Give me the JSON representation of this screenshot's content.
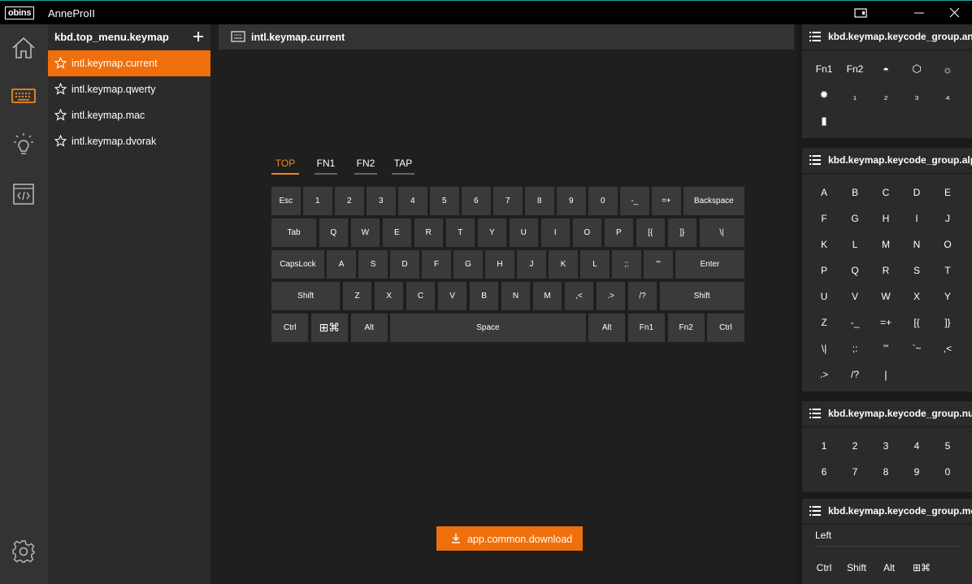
{
  "titlebar": {
    "logo": "obins",
    "app_title": "AnneProII"
  },
  "rail": {
    "items": [
      "home-icon",
      "keyboard-icon",
      "lightbulb-icon",
      "code-icon"
    ],
    "active": "keyboard-icon",
    "settings": "gear-icon"
  },
  "list": {
    "header": "kbd.top_menu.keymap",
    "add_icon": "plus-icon",
    "items": [
      {
        "label": "intl.keymap.current",
        "active": true
      },
      {
        "label": "intl.keymap.qwerty",
        "active": false
      },
      {
        "label": "intl.keymap.mac",
        "active": false
      },
      {
        "label": "intl.keymap.dvorak",
        "active": false
      }
    ]
  },
  "main": {
    "title": "intl.keymap.current",
    "tabs": [
      "TOP",
      "FN1",
      "FN2",
      "TAP"
    ],
    "active_tab": "TOP",
    "download_label": "app.common.download"
  },
  "keyboard": {
    "rows": [
      [
        {
          "l": "Esc",
          "w": 1
        },
        {
          "l": "1",
          "w": 1
        },
        {
          "l": "2",
          "w": 1
        },
        {
          "l": "3",
          "w": 1
        },
        {
          "l": "4",
          "w": 1
        },
        {
          "l": "5",
          "w": 1
        },
        {
          "l": "6",
          "w": 1
        },
        {
          "l": "7",
          "w": 1
        },
        {
          "l": "8",
          "w": 1
        },
        {
          "l": "9",
          "w": 1
        },
        {
          "l": "0",
          "w": 1
        },
        {
          "l": "-_",
          "w": 1
        },
        {
          "l": "=+",
          "w": 1
        },
        {
          "l": "Backspace",
          "w": 2
        }
      ],
      [
        {
          "l": "Tab",
          "w": 1.5
        },
        {
          "l": "Q",
          "w": 1
        },
        {
          "l": "W",
          "w": 1
        },
        {
          "l": "E",
          "w": 1
        },
        {
          "l": "R",
          "w": 1
        },
        {
          "l": "T",
          "w": 1
        },
        {
          "l": "Y",
          "w": 1
        },
        {
          "l": "U",
          "w": 1
        },
        {
          "l": "I",
          "w": 1
        },
        {
          "l": "O",
          "w": 1
        },
        {
          "l": "P",
          "w": 1
        },
        {
          "l": "[{",
          "w": 1
        },
        {
          "l": "]}",
          "w": 1
        },
        {
          "l": "\\|",
          "w": 1.5
        }
      ],
      [
        {
          "l": "CapsLock",
          "w": 1.75
        },
        {
          "l": "A",
          "w": 1
        },
        {
          "l": "S",
          "w": 1
        },
        {
          "l": "D",
          "w": 1
        },
        {
          "l": "F",
          "w": 1
        },
        {
          "l": "G",
          "w": 1
        },
        {
          "l": "H",
          "w": 1
        },
        {
          "l": "J",
          "w": 1
        },
        {
          "l": "K",
          "w": 1
        },
        {
          "l": "L",
          "w": 1
        },
        {
          "l": ";:",
          "w": 1
        },
        {
          "l": "'\"",
          "w": 1
        },
        {
          "l": "Enter",
          "w": 2.25
        }
      ],
      [
        {
          "l": "Shift",
          "w": 2.25
        },
        {
          "l": "Z",
          "w": 1
        },
        {
          "l": "X",
          "w": 1
        },
        {
          "l": "C",
          "w": 1
        },
        {
          "l": "V",
          "w": 1
        },
        {
          "l": "B",
          "w": 1
        },
        {
          "l": "N",
          "w": 1
        },
        {
          "l": "M",
          "w": 1
        },
        {
          "l": ",<",
          "w": 1
        },
        {
          "l": ".>",
          "w": 1
        },
        {
          "l": "/?",
          "w": 1
        },
        {
          "l": "Shift",
          "w": 2.75
        }
      ],
      [
        {
          "l": "Ctrl",
          "w": 1.25
        },
        {
          "l": "⊞⌘",
          "w": 1.25
        },
        {
          "l": "Alt",
          "w": 1.25
        },
        {
          "l": "Space",
          "w": 6.25
        },
        {
          "l": "Alt",
          "w": 1.25
        },
        {
          "l": "Fn1",
          "w": 1.25
        },
        {
          "l": "Fn2",
          "w": 1.25
        },
        {
          "l": "Ctrl",
          "w": 1.25
        }
      ]
    ]
  },
  "groups": [
    {
      "title": "kbd.keymap.keycode_group.an",
      "keys": [
        "Fn1",
        "Fn2",
        "◓",
        "⬡",
        "☼",
        "✹",
        "₁",
        "₂",
        "₃",
        "₄",
        "▮"
      ]
    },
    {
      "title": "kbd.keymap.keycode_group.alp",
      "keys": [
        "A",
        "B",
        "C",
        "D",
        "E",
        "F",
        "G",
        "H",
        "I",
        "J",
        "K",
        "L",
        "M",
        "N",
        "O",
        "P",
        "Q",
        "R",
        "S",
        "T",
        "U",
        "V",
        "W",
        "X",
        "Y",
        "Z",
        "-_",
        "=+",
        "[{",
        "]}",
        "\\|",
        ";:",
        "'\"",
        "`~",
        ",<",
        ".>",
        "/?",
        "|"
      ]
    },
    {
      "title": "kbd.keymap.keycode_group.nu",
      "keys": [
        "1",
        "2",
        "3",
        "4",
        "5",
        "6",
        "7",
        "8",
        "9",
        "0"
      ]
    },
    {
      "title": "kbd.keymap.keycode_group.mo",
      "subheader": "Left",
      "keys": [
        "Ctrl",
        "Shift",
        "Alt",
        "⊞⌘"
      ]
    }
  ],
  "colors": {
    "accent": "#ee6f0c",
    "tab_active": "#ee8a1a",
    "background": "#1f1f1f",
    "rail": "#333333",
    "key": "#3a3a3a"
  }
}
